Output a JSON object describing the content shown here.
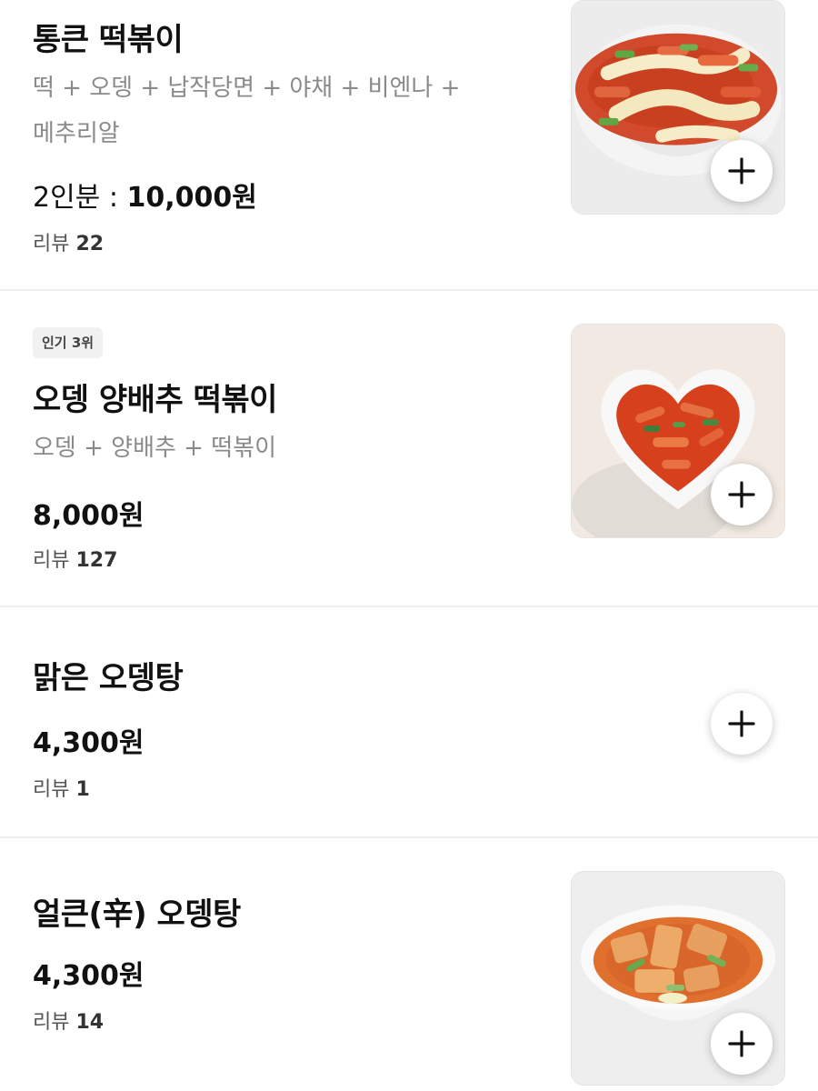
{
  "menu_items": [
    {
      "name": "통큰 떡볶이",
      "description": "떡 + 오뎅 + 납작당면 + 야채 + 비엔나 + 메추리알",
      "price_prefix": "2인분 : ",
      "price": "10,000원",
      "review_label": "리뷰 ",
      "review_count": "22",
      "image": "tteokbokki-with-cheese-photo",
      "add_icon": "plus-icon"
    },
    {
      "badge": "인기 3위",
      "name": "오뎅 양배추 떡볶이",
      "description": "오뎅 + 양배추 + 떡볶이",
      "price": "8,000원",
      "review_label": "리뷰 ",
      "review_count": "127",
      "image": "heart-bowl-tteokbokki-photo",
      "add_icon": "plus-icon"
    },
    {
      "name": "맑은 오뎅탕",
      "price": "4,300원",
      "review_label": "리뷰 ",
      "review_count": "1",
      "add_icon": "plus-icon"
    },
    {
      "name": "얼큰(辛) 오뎅탕",
      "price": "4,300원",
      "review_label": "리뷰 ",
      "review_count": "14",
      "image": "spicy-fishcake-soup-photo",
      "add_icon": "plus-icon"
    }
  ],
  "colors": {
    "text_primary": "#111111",
    "text_secondary": "#8a8a8a",
    "divider": "#eeeeee",
    "badge_bg": "#f1f1f1"
  }
}
